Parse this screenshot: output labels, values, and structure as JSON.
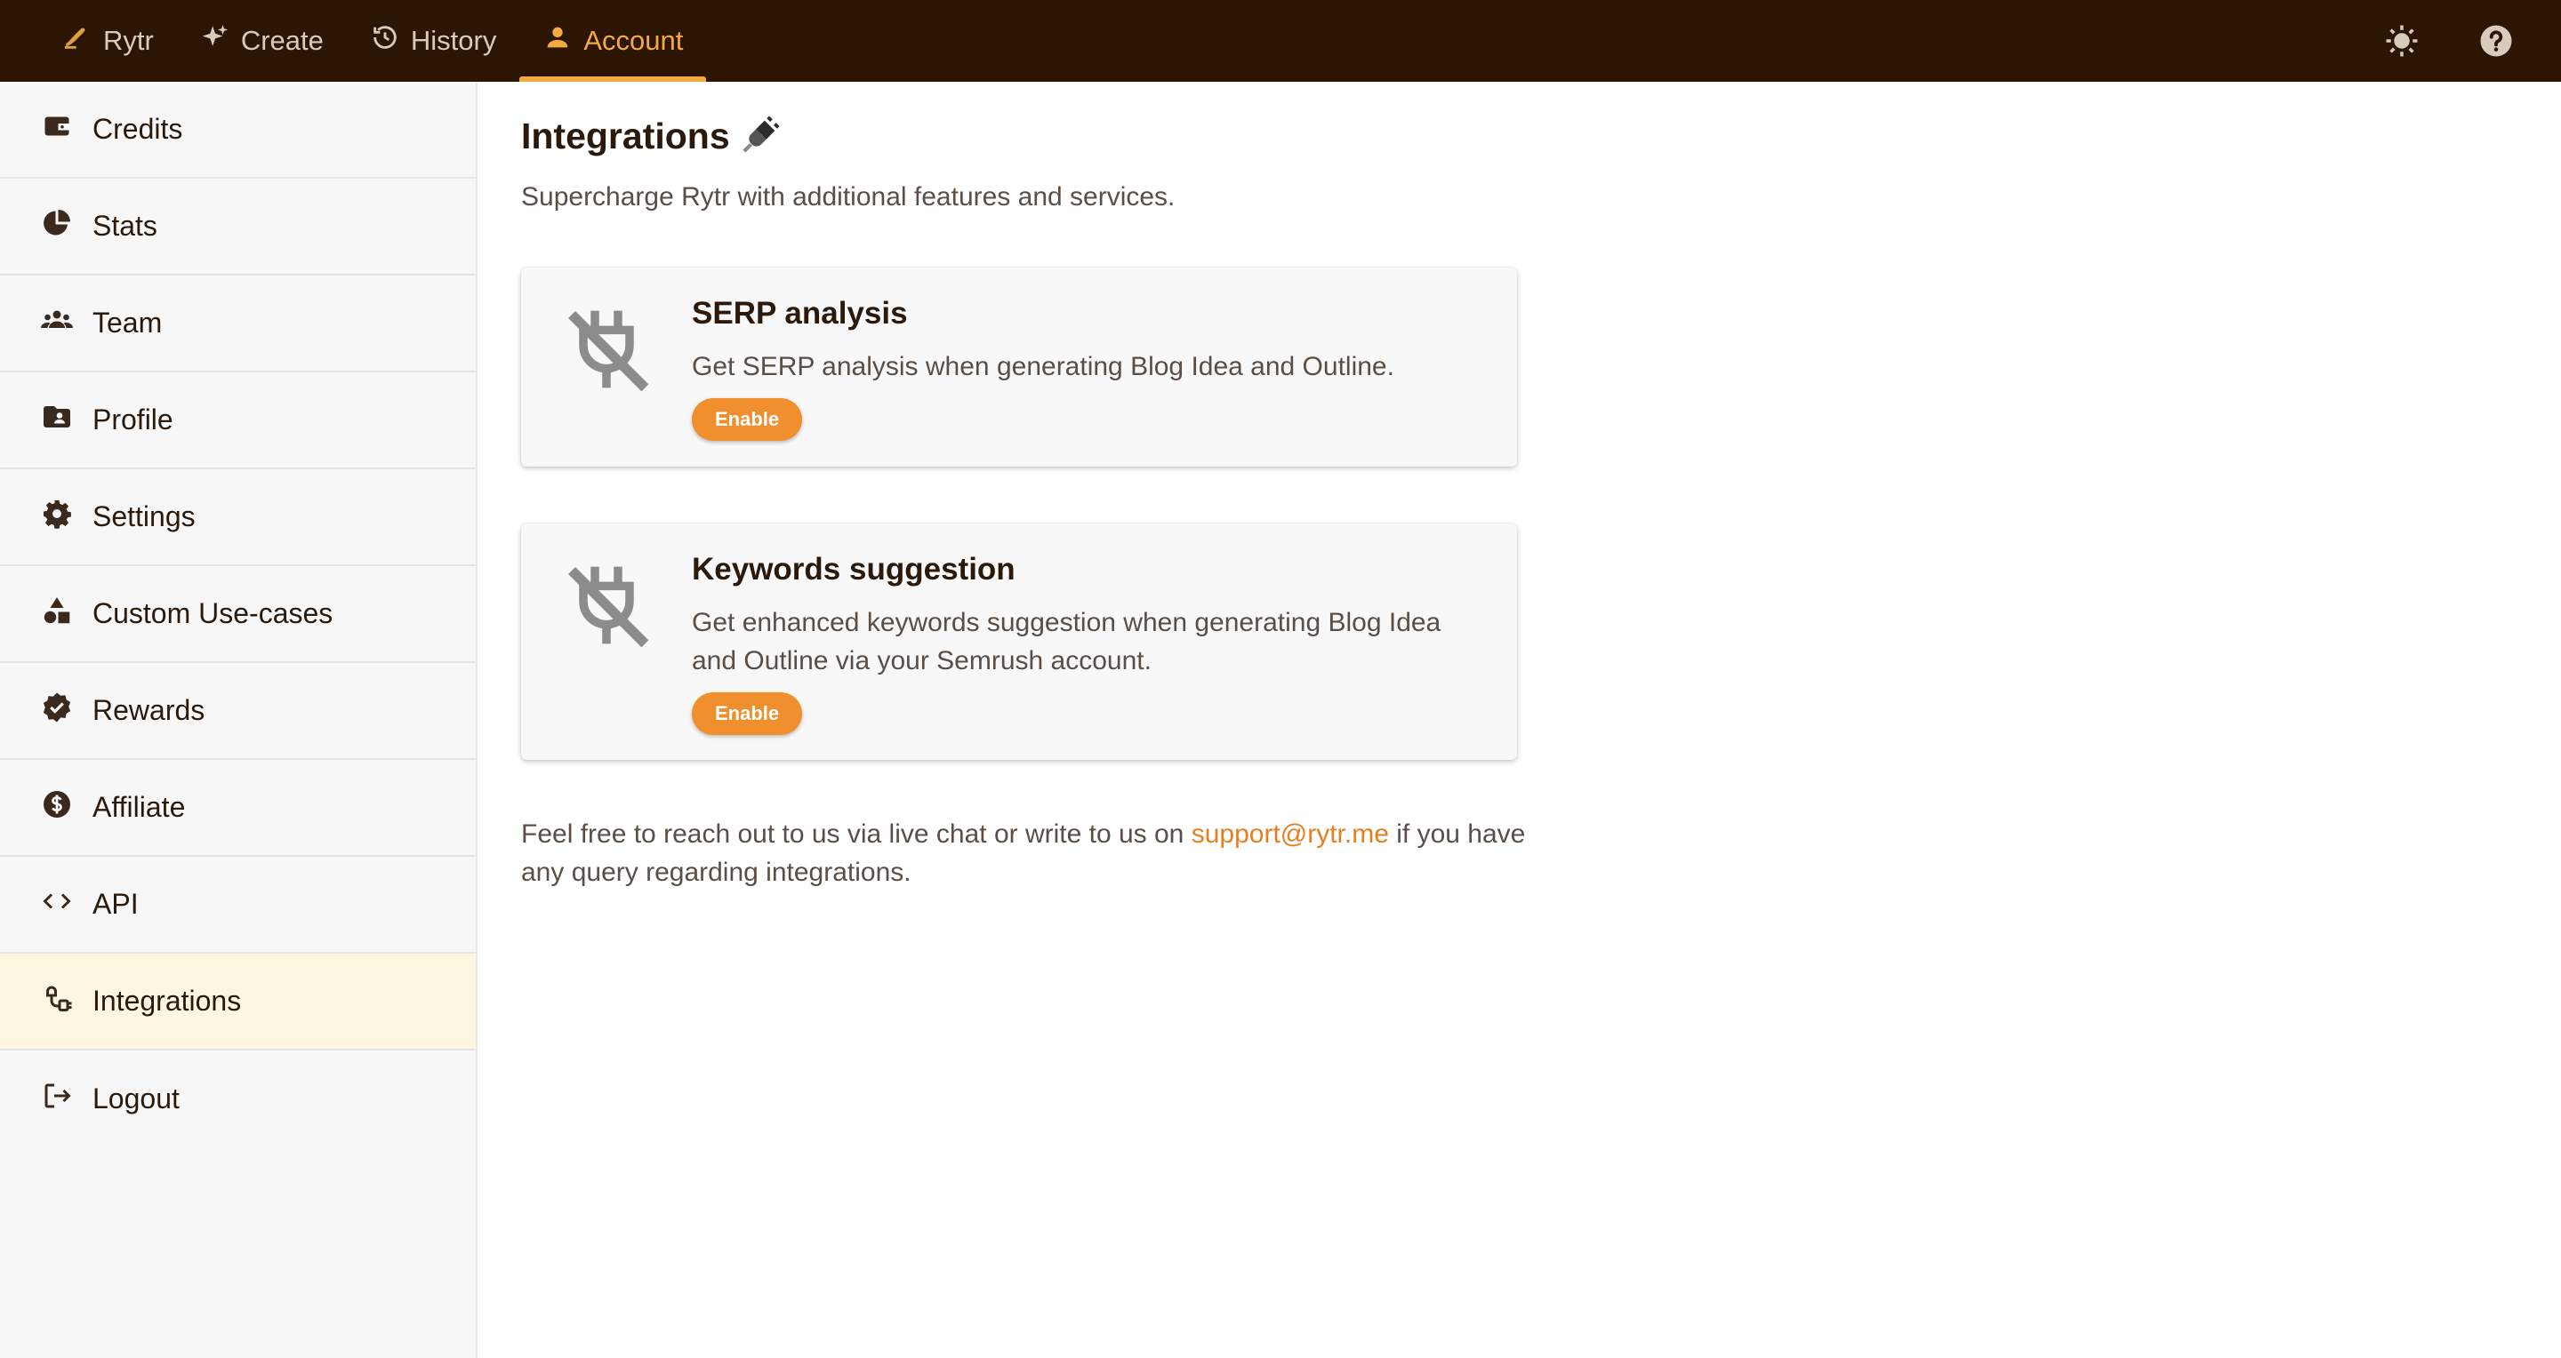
{
  "topbar": {
    "nav": [
      {
        "label": "Rytr",
        "icon": "rytr-logo-icon"
      },
      {
        "label": "Create",
        "icon": "sparkle-icon"
      },
      {
        "label": "History",
        "icon": "history-icon"
      },
      {
        "label": "Account",
        "icon": "user-icon",
        "active": true
      }
    ],
    "right_icons": [
      "theme-toggle-sun-icon",
      "help-icon"
    ]
  },
  "sidebar": {
    "items": [
      {
        "label": "Credits",
        "icon": "wallet-icon"
      },
      {
        "label": "Stats",
        "icon": "pie-chart-icon"
      },
      {
        "label": "Team",
        "icon": "team-icon"
      },
      {
        "label": "Profile",
        "icon": "profile-folder-icon"
      },
      {
        "label": "Settings",
        "icon": "gear-icon"
      },
      {
        "label": "Custom Use-cases",
        "icon": "shapes-icon"
      },
      {
        "label": "Rewards",
        "icon": "badge-check-icon"
      },
      {
        "label": "Affiliate",
        "icon": "dollar-icon"
      },
      {
        "label": "API",
        "icon": "code-icon"
      },
      {
        "label": "Integrations",
        "icon": "integration-icon",
        "active": true
      },
      {
        "label": "Logout",
        "icon": "logout-icon"
      }
    ]
  },
  "main": {
    "title": "Integrations",
    "subtitle": "Supercharge Rytr with additional features and services.",
    "cards": [
      {
        "title": "SERP analysis",
        "description": "Get SERP analysis when generating Blog Idea and Outline.",
        "button": "Enable",
        "icon": "plug-off-icon"
      },
      {
        "title": "Keywords suggestion",
        "description": "Get enhanced keywords suggestion when generating Blog Idea and Outline via your Semrush account.",
        "button": "Enable",
        "icon": "plug-off-icon"
      }
    ],
    "footer": {
      "before": "Feel free to reach out to us via live chat or write to us on ",
      "link": "support@rytr.me",
      "after": " if you have any query regarding integrations."
    }
  },
  "colors": {
    "topbar_bg": "#2c1503",
    "accent": "#f4a940",
    "button": "#ef8f2d",
    "link": "#e67f22",
    "sidebar_active": "#fdf7e1"
  }
}
